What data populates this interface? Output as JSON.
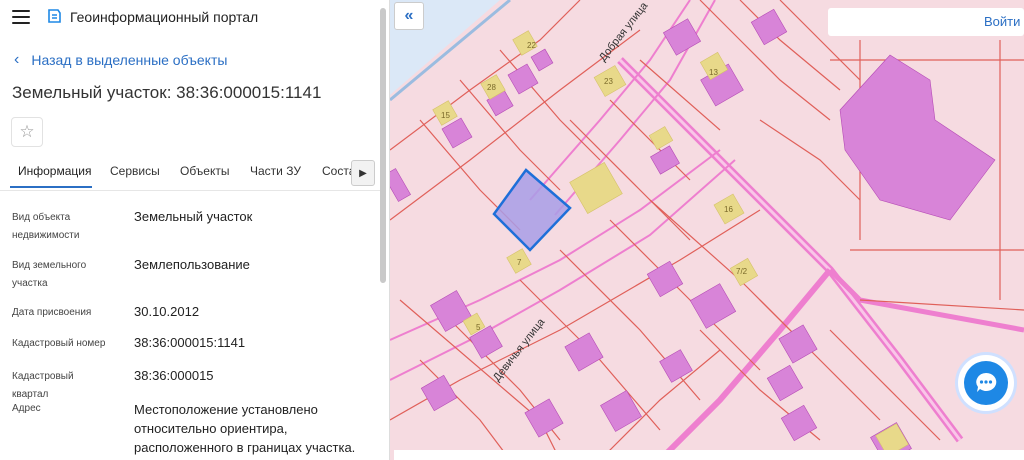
{
  "header": {
    "app_title": "Геоинформационный портал"
  },
  "back_link": {
    "label": "Назад в выделенные объекты"
  },
  "object": {
    "title": "Земельный участок: 38:36:000015:1141"
  },
  "tabs": [
    {
      "label": "Информация",
      "active": true
    },
    {
      "label": "Сервисы",
      "active": false
    },
    {
      "label": "Объекты",
      "active": false
    },
    {
      "label": "Части ЗУ",
      "active": false
    },
    {
      "label": "Соста",
      "active": false
    }
  ],
  "info": [
    {
      "label": "Вид объекта недвижимости",
      "value": "Земельный участок"
    },
    {
      "label": "Вид земельного участка",
      "value": "Землепользование"
    },
    {
      "label": "Дата присвоения",
      "value": "30.10.2012"
    },
    {
      "label": "Кадастровый номер",
      "value": "38:36:000015:1141"
    },
    {
      "label": "Кадастровый квартал",
      "value": "38:36:000015"
    },
    {
      "label": "Адрес",
      "value": "Местоположение установлено относительно ориентира, расположенного в границах участка."
    }
  ],
  "map": {
    "login_label": "Войти",
    "street_labels": [
      "Добрая улица",
      "Девичья улица"
    ],
    "house_numbers": [
      "22",
      "23",
      "13",
      "28",
      "15",
      "16",
      "7",
      "7/2",
      "5"
    ],
    "colors": {
      "background": "#f6dbe1",
      "parcel_line": "#e0605a",
      "building": "#d884d8",
      "road": "#ee7fcf",
      "selected_fill": "#a89de6",
      "selected_stroke": "#1e6fd9",
      "label_marker": "#e8d98a"
    }
  }
}
